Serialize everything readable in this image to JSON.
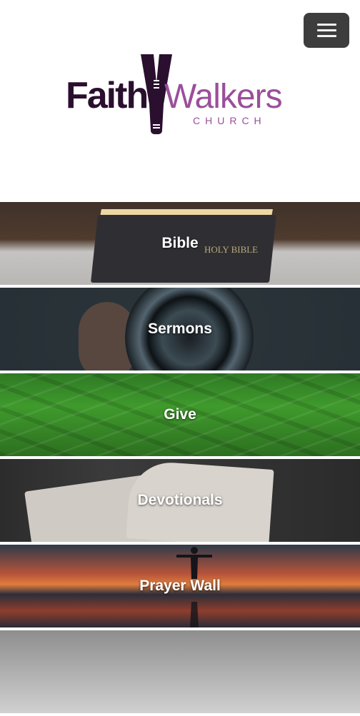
{
  "header": {
    "menu_icon": "hamburger-icon",
    "logo": {
      "word1": "Faith",
      "word2": "Walkers",
      "word3": "CHURCH"
    }
  },
  "colors": {
    "logo_dark": "#2a0f2e",
    "logo_purple": "#9a4f9a",
    "menu_button": "#3d3d3d"
  },
  "tiles": [
    {
      "label": "Bible"
    },
    {
      "label": "Sermons"
    },
    {
      "label": "Give"
    },
    {
      "label": "Devotionals"
    },
    {
      "label": "Prayer Wall"
    }
  ],
  "bible_cover": "HOLY BIBLE"
}
